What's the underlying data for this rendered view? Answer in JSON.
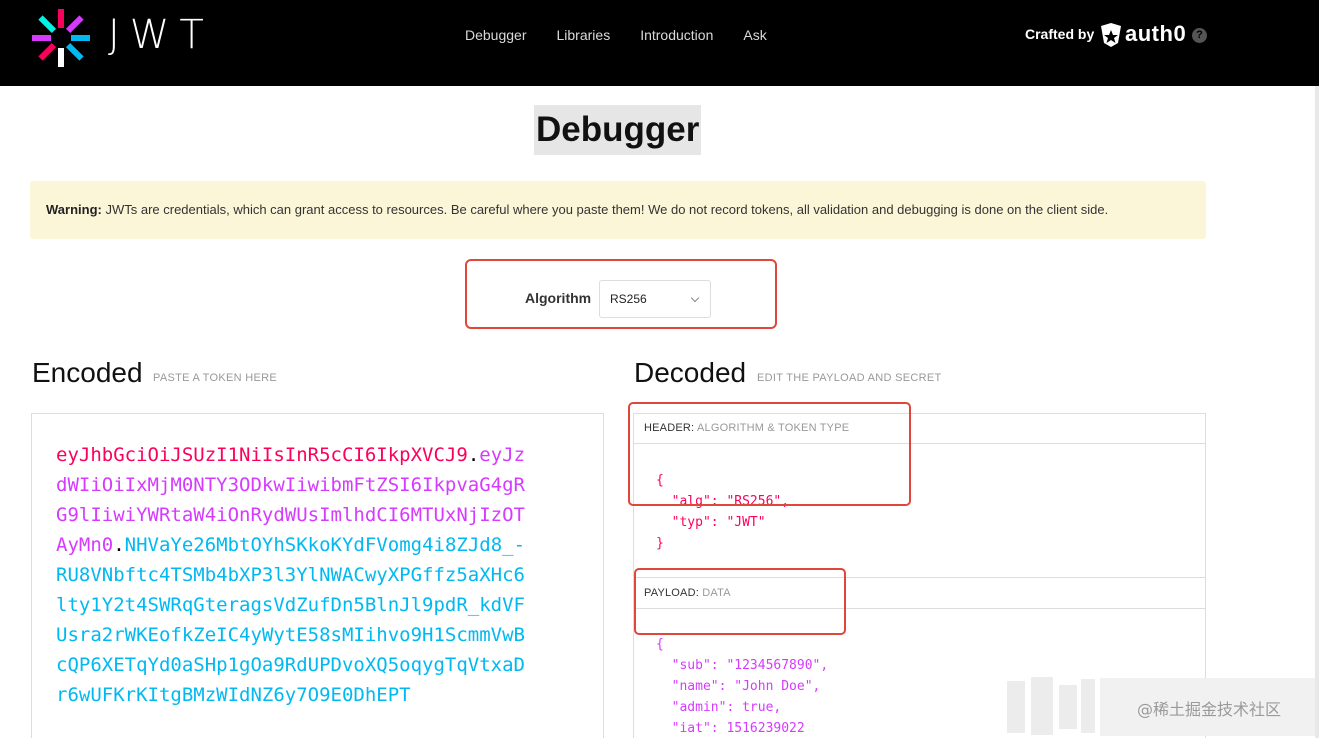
{
  "nav": {
    "logo_text": "JWT",
    "links": [
      "Debugger",
      "Libraries",
      "Introduction",
      "Ask"
    ],
    "crafted_by": "Crafted by",
    "brand": "auth0",
    "help": "?"
  },
  "page": {
    "title": "Debugger",
    "warning_bold": "Warning:",
    "warning_text": " JWTs are credentials, which can grant access to resources. Be careful where you paste them! We do not record tokens, all validation and debugging is done on the client side."
  },
  "algorithm": {
    "label": "Algorithm",
    "selected": "RS256"
  },
  "encoded": {
    "heading": "Encoded",
    "subheading": "PASTE A TOKEN HERE",
    "header_part": "eyJhbGciOiJSUzI1NiIsInR5cCI6IkpXVCJ9",
    "payload_part": "eyJzdWIiOiIxMjM0NTY3ODkwIiwibmFtZSI6IkpvaG4gRG9lIiwiYWRtaW4iOnRydWUsImlhdCI6MTUxNjIzOTAyMn0",
    "signature_part": "NHVaYe26MbtOYhSKkoKYdFVomg4i8ZJd8_-RU8VNbftc4TSMb4bXP3l3YlNWACwyXPGffz5aXHc6lty1Y2t4SWRqGteragsVdZufDn5BlnJl9pdR_kdVFUsra2rWKEofkZeIC4yWytE58sMIihvo9H1ScmmVwBcQP6XETqYd0aSHp1gOa9RdUPDvoXQ5oqygTqVtxaDr6wUFKrKItgBMzWIdNZ6y7O9E0DhEPT",
    "dot": "."
  },
  "decoded": {
    "heading": "Decoded",
    "subheading": "EDIT THE PAYLOAD AND SECRET",
    "header_title": "HEADER:",
    "header_sub": "ALGORITHM & TOKEN TYPE",
    "header_json": "{\n  \"alg\": \"RS256\",\n  \"typ\": \"JWT\"\n}",
    "payload_title": "PAYLOAD:",
    "payload_sub": "DATA",
    "payload_json": "{\n  \"sub\": \"1234567890\",\n  \"name\": \"John Doe\",\n  \"admin\": true,\n  \"iat\": 1516239022"
  },
  "watermark": "@稀土掘金技术社区",
  "colors": {
    "topbar": "#000000",
    "token_header": "#fb015b",
    "token_payload": "#d63aff",
    "token_signature": "#00b9f1",
    "highlight_box": "#e0463a",
    "warning_bg": "#fbf6d7"
  }
}
